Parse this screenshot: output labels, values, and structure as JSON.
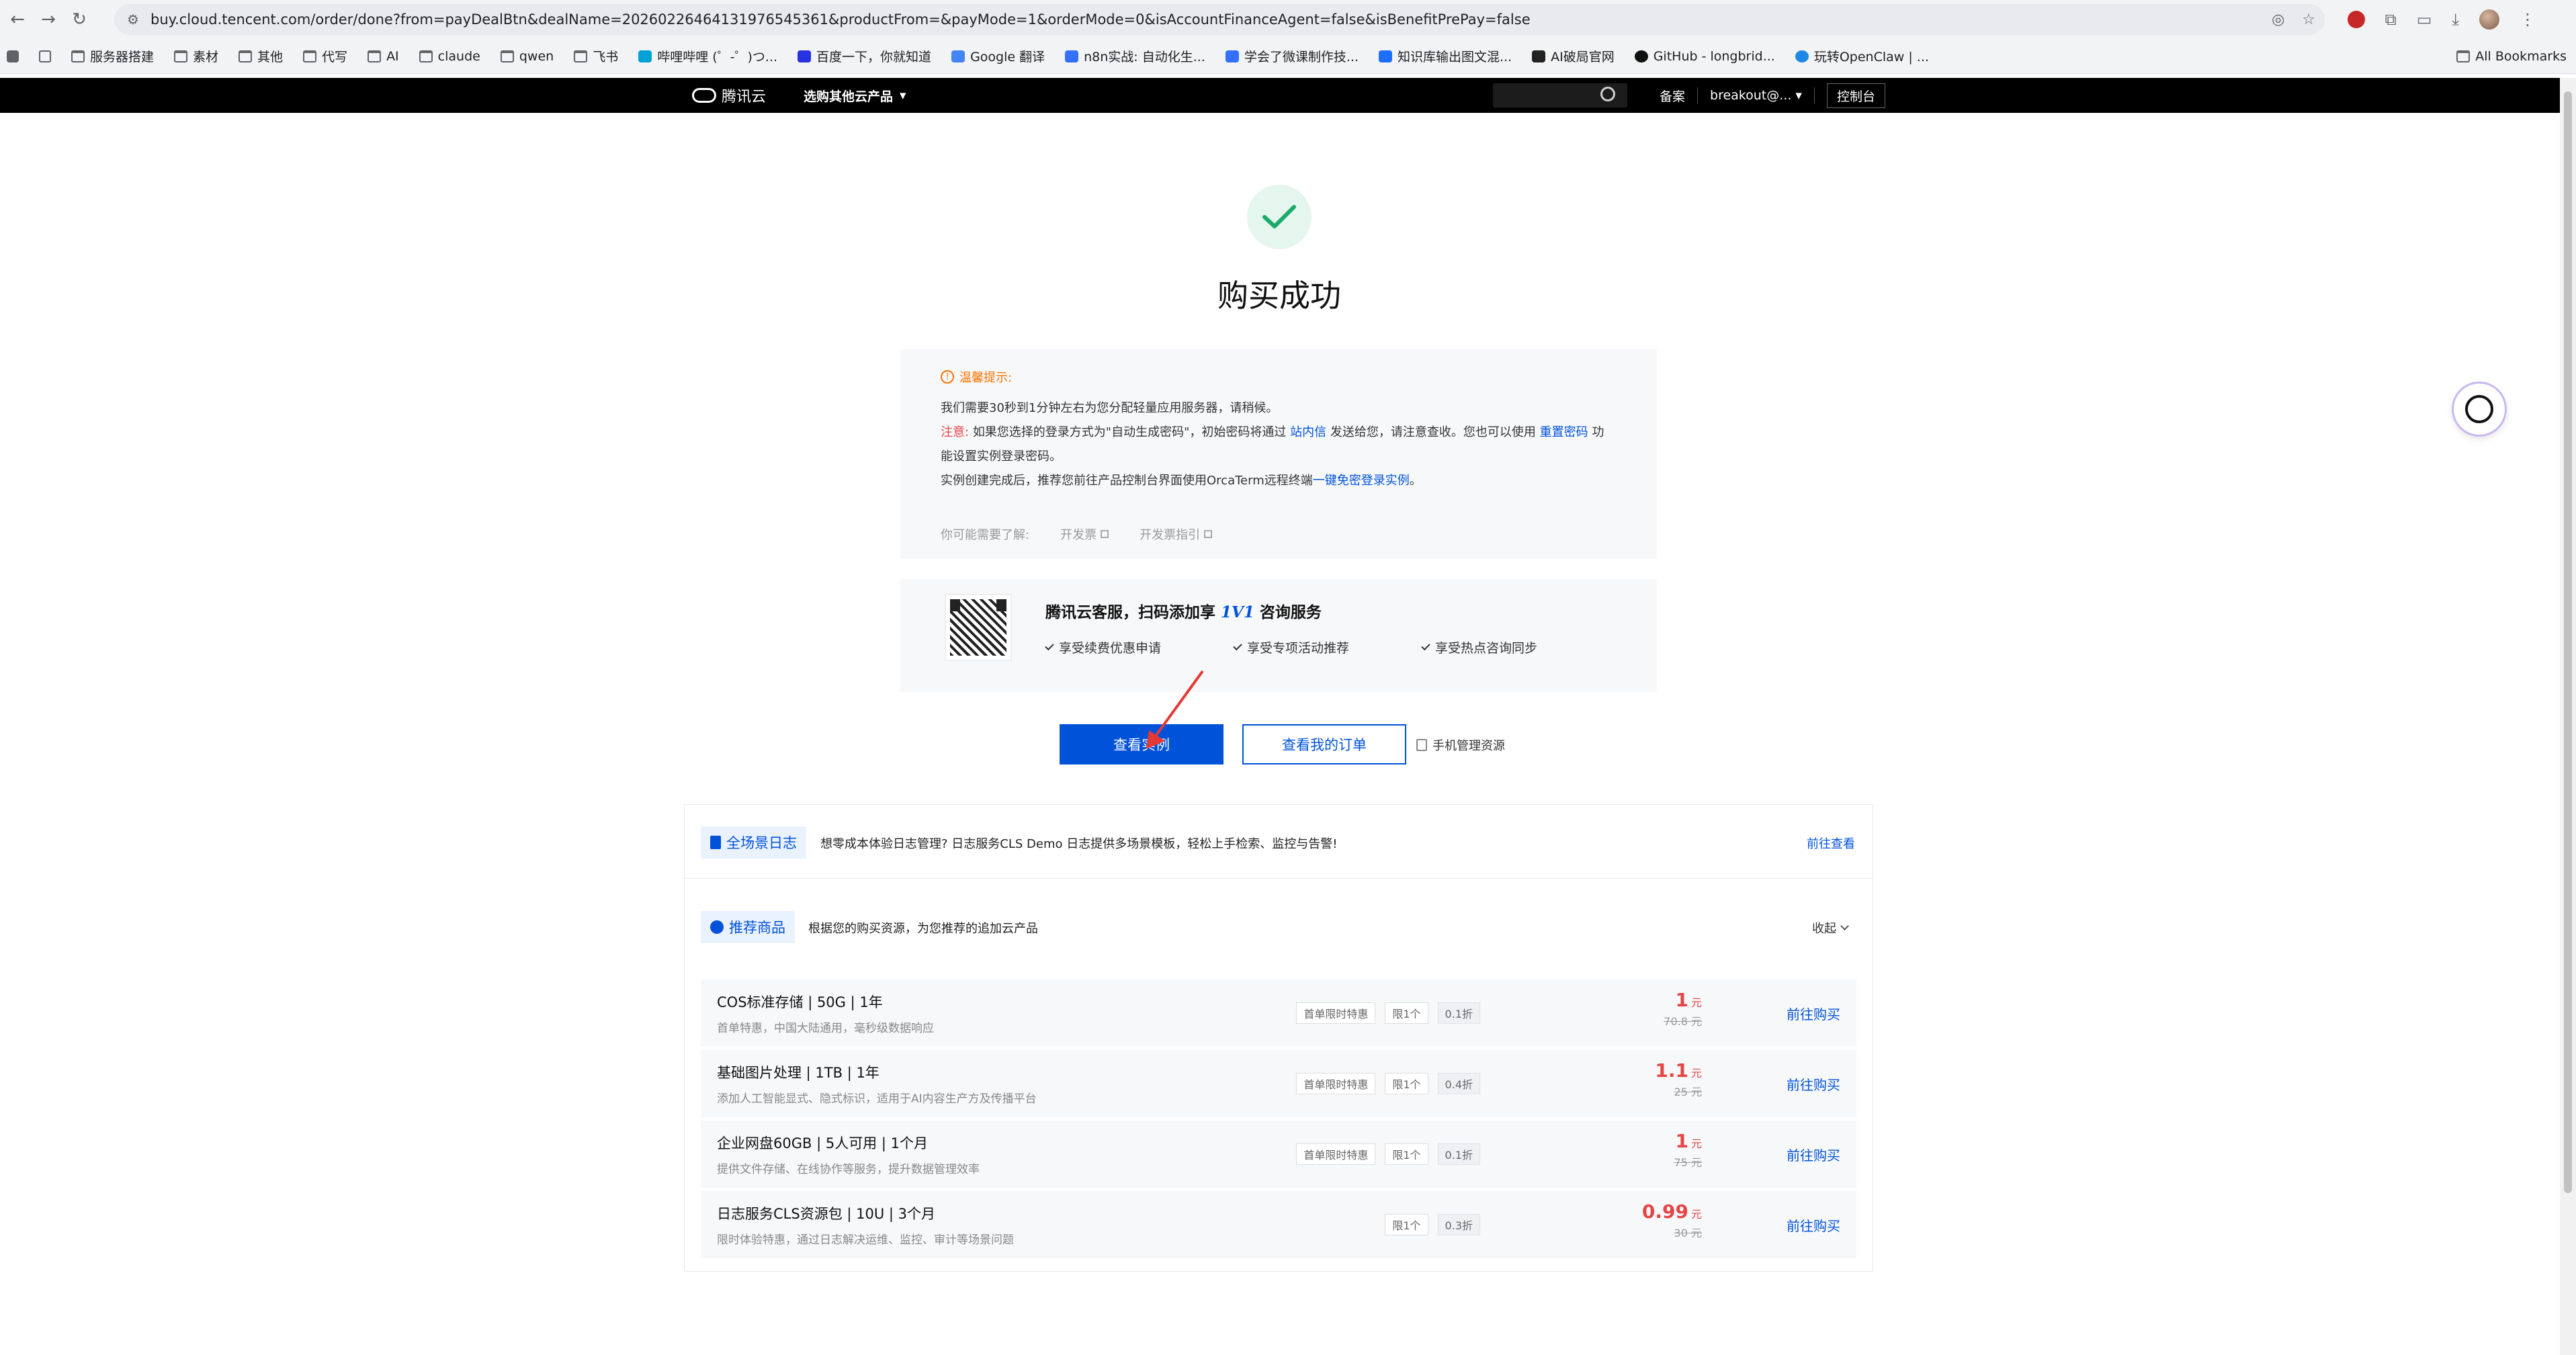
{
  "browser": {
    "url": "buy.cloud.tencent.com/order/done?from=payDealBtn&dealName=20260226464131976545361&productFrom=&payMode=1&orderMode=0&isAccountFinanceAgent=false&isBenefitPrePay=false",
    "bookmarks": [
      {
        "label": "服务器搭建",
        "icon": "folder-icon"
      },
      {
        "label": "素材",
        "icon": "folder-icon"
      },
      {
        "label": "其他",
        "icon": "folder-icon"
      },
      {
        "label": "代写",
        "icon": "folder-icon"
      },
      {
        "label": "AI",
        "icon": "folder-icon"
      },
      {
        "label": "claude",
        "icon": "folder-icon"
      },
      {
        "label": "qwen",
        "icon": "folder-icon"
      },
      {
        "label": "飞书",
        "icon": "folder-icon"
      },
      {
        "label": "哔哩哔哩 (゜-゜)つ...",
        "icon": "bilibili-icon"
      },
      {
        "label": "百度一下，你就知道",
        "icon": "baidu-icon"
      },
      {
        "label": "Google 翻译",
        "icon": "google-translate-icon"
      },
      {
        "label": "n8n实战: 自动化生...",
        "icon": "doc-icon"
      },
      {
        "label": "学会了微课制作技...",
        "icon": "doc-icon"
      },
      {
        "label": "知识库输出图文混...",
        "icon": "site-icon"
      },
      {
        "label": "AI破局官网",
        "icon": "site-icon"
      },
      {
        "label": "GitHub - longbrid...",
        "icon": "github-icon"
      },
      {
        "label": "玩转OpenClaw | ...",
        "icon": "cloud-icon"
      }
    ],
    "all_bookmarks": "All Bookmarks"
  },
  "header": {
    "logo": "腾讯云",
    "product_menu": "选购其他云产品",
    "filing": "备案",
    "account": "breakout@...",
    "console": "控制台"
  },
  "main": {
    "title": "购买成功",
    "notice": {
      "head": "温馨提示:",
      "line1": "我们需要30秒到1分钟左右为您分配轻量应用服务器，请稍候。",
      "line2_warn": "注意:",
      "line2_a": "如果您选择的登录方式为\"自动生成密码\"，初始密码将通过",
      "line2_link1": "站内信",
      "line2_b": "发送给您，请注意查收。您也可以使用",
      "line2_link2": "重置密码",
      "line2_c": "功",
      "line3": "能设置实例登录密码。",
      "line4_a": "实例创建完成后，推荐您前往产品控制台界面使用OrcaTerm远程终端",
      "line4_link": "一键免密登录实例",
      "line4_b": "。",
      "more_label": "你可能需要了解:",
      "more_links": [
        "开发票",
        "开发票指引"
      ]
    },
    "service": {
      "title_a": "腾讯云客服，扫码添加享",
      "title_hl": "1V1",
      "title_b": "咨询服务",
      "benefits": [
        "享受续费优惠申请",
        "享受专项活动推荐",
        "享受热点咨询同步"
      ]
    },
    "btn_view_instance": "查看实例",
    "btn_view_orders": "查看我的订单",
    "mobile_manage": "手机管理资源"
  },
  "cls": {
    "tag": "全场景日志",
    "text": "想零成本体验日志管理? 日志服务CLS Demo 日志提供多场景模板，轻松上手检索、监控与告警!",
    "link": "前往查看"
  },
  "recommend": {
    "tag": "推荐商品",
    "text": "根据您的购买资源，为您推荐的追加云产品",
    "collapse": "收起",
    "unit": "元",
    "buy_label": "前往购买",
    "products": [
      {
        "name": "COS标准存储 | 50G | 1年",
        "desc": "首单特惠，中国大陆通用，毫秒级数据响应",
        "tags": [
          "首单限时特惠",
          "限1个",
          "0.1折"
        ],
        "price": "1",
        "original": "70.8"
      },
      {
        "name": "基础图片处理 | 1TB | 1年",
        "desc": "添加人工智能显式、隐式标识，适用于AI内容生产方及传播平台",
        "tags": [
          "首单限时特惠",
          "限1个",
          "0.4折"
        ],
        "price": "1.1",
        "original": "25"
      },
      {
        "name": "企业网盘60GB | 5人可用 | 1个月",
        "desc": "提供文件存储、在线协作等服务，提升数据管理效率",
        "tags": [
          "首单限时特惠",
          "限1个",
          "0.1折"
        ],
        "price": "1",
        "original": "75"
      },
      {
        "name": "日志服务CLS资源包 | 10U | 3个月",
        "desc": "限时体验特惠，通过日志解决运维、监控、审计等场景问题",
        "tags": [
          "限1个",
          "0.3折"
        ],
        "price": "0.99",
        "original": "30"
      }
    ]
  },
  "colors": {
    "primary": "#0052d9",
    "price": "#e54545",
    "success": "#1aaa6b",
    "warning": "#ff7200"
  }
}
